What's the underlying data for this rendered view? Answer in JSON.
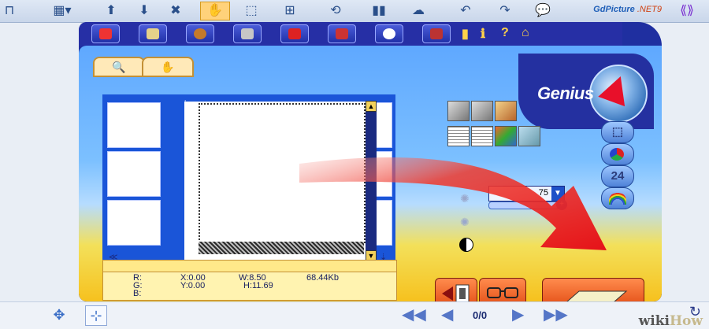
{
  "toolbar": {
    "brand_name": "GdPicture",
    "brand_version": ".NET9"
  },
  "scanner": {
    "logo_text": "Genius",
    "preview": {
      "corner_label": "in"
    },
    "status": {
      "r_label": "R:",
      "g_label": "G:",
      "b_label": "B:",
      "x_value": "X:0.00",
      "y_value": "Y:0.00",
      "w_value": "W:8.50",
      "h_value": "H:11.69",
      "size_value": "68.44Kb"
    },
    "quality_value": "75",
    "bit_depth_label": "24"
  },
  "bottombar": {
    "page_indicator": "0/0",
    "watermark_a": "wiki",
    "watermark_b": "How"
  },
  "colors": {
    "frame_blue": "#1f2fa0",
    "panel_yellow": "#f6c11e",
    "arrow_red": "#e8161c",
    "accent_orange": "#e14a12"
  }
}
